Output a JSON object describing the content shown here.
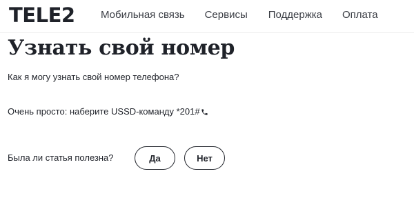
{
  "header": {
    "logo": "TELE2",
    "nav": [
      {
        "label": "Мобильная связь"
      },
      {
        "label": "Сервисы"
      },
      {
        "label": "Поддержка"
      },
      {
        "label": "Оплата"
      }
    ]
  },
  "article": {
    "title": "Узнать свой номер",
    "question": "Как я могу узнать свой номер телефона?",
    "answer": "Очень просто: наберите USSD-команду *201#",
    "answer_icon": "phone-icon"
  },
  "feedback": {
    "label": "Была ли статья полезна?",
    "yes_label": "Да",
    "no_label": "Нет"
  }
}
